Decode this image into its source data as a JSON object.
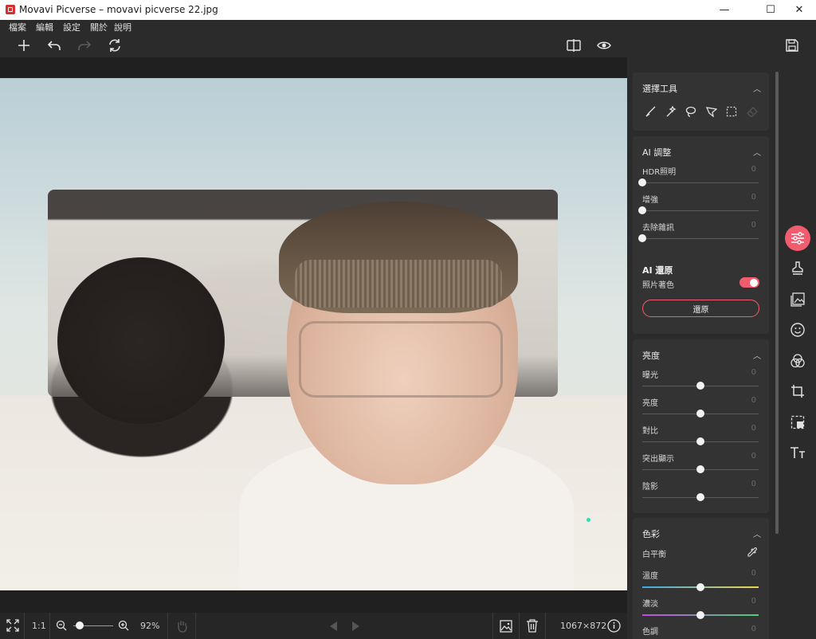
{
  "window": {
    "title": "Movavi Picverse – movavi picverse 22.jpg",
    "minimize": "—",
    "maximize": "☐",
    "close": "✕"
  },
  "menu": [
    "檔案",
    "編輯",
    "設定",
    "關於",
    "說明"
  ],
  "toolbar": {
    "icons": [
      "add-icon",
      "undo-icon",
      "redo-icon",
      "reset-icon",
      "compare-icon",
      "preview-eye-icon",
      "save-icon"
    ]
  },
  "panel": {
    "selection": {
      "title": "選擇工具",
      "tools": [
        "brush-icon",
        "magic-wand-icon",
        "lasso-icon",
        "polygon-lasso-icon",
        "rect-select-icon",
        "eraser-icon"
      ]
    },
    "ai_adjust": {
      "title": "AI 調整",
      "sliders": [
        {
          "label": "HDR照明",
          "value": "0"
        },
        {
          "label": "增強",
          "value": "0"
        },
        {
          "label": "去除雜訊",
          "value": "0"
        }
      ]
    },
    "ai_restore": {
      "title": "AI 還原",
      "toggle_label": "照片著色",
      "toggle_on": true,
      "button_label": "還原"
    },
    "brightness": {
      "title": "亮度",
      "sliders": [
        {
          "label": "曝光",
          "value": "0"
        },
        {
          "label": "亮度",
          "value": "0"
        },
        {
          "label": "對比",
          "value": "0"
        },
        {
          "label": "突出顯示",
          "value": "0"
        },
        {
          "label": "陰影",
          "value": "0"
        }
      ]
    },
    "color": {
      "title": "色彩",
      "white_balance_label": "白平衡",
      "sliders": [
        {
          "label": "溫度",
          "value": "0"
        },
        {
          "label": "濃淡",
          "value": "0"
        },
        {
          "label": "色調",
          "value": "0"
        }
      ]
    }
  },
  "sidebar": {
    "icons": [
      "adjust-sliders-icon",
      "stamp-icon",
      "image-icon",
      "face-icon",
      "color-circles-icon",
      "crop-icon",
      "select-area-icon",
      "text-icon"
    ]
  },
  "bottom": {
    "ratio_label": "1:1",
    "zoom_label": "92%",
    "zoom_value": 0.05,
    "image_size": "1067×872"
  },
  "colors": {
    "accent": "#f15d6e",
    "panel_bg": "#2b2b2b",
    "card_bg": "#333333"
  }
}
